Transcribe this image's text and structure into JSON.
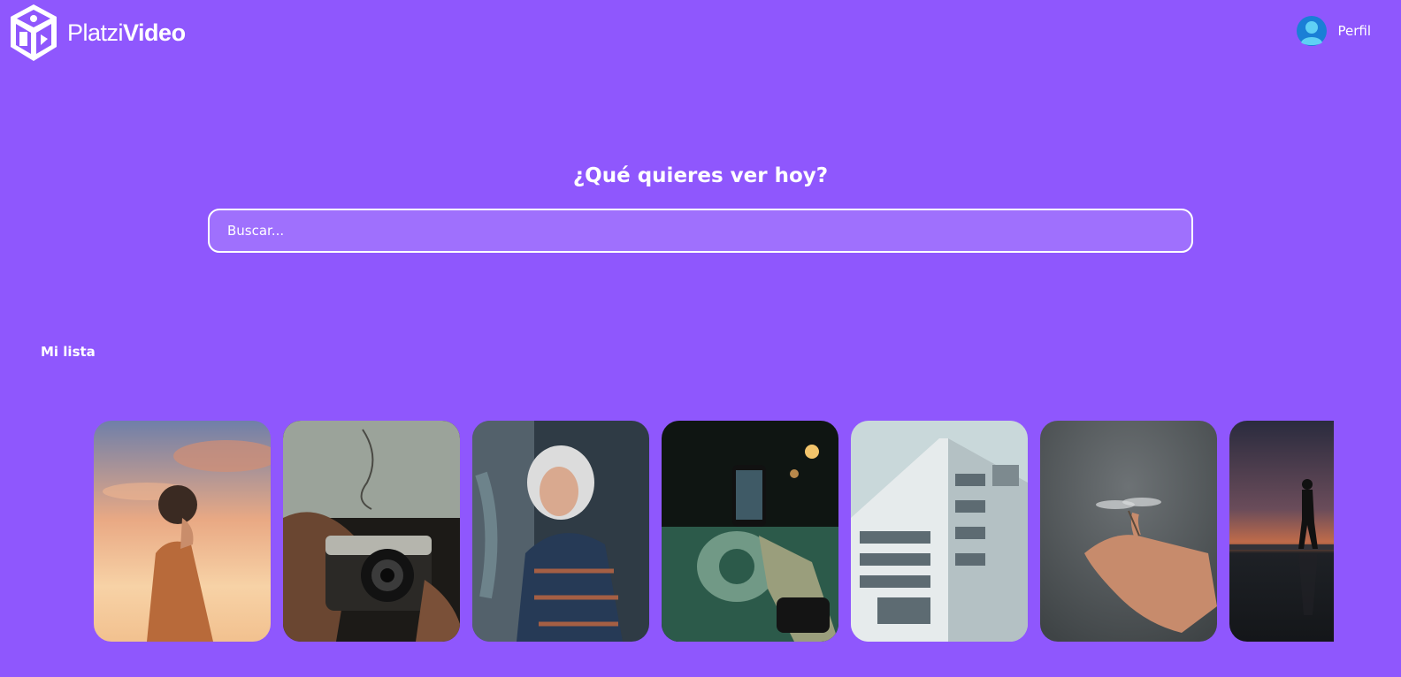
{
  "header": {
    "logo": {
      "name_light": "Platzi",
      "name_bold": "Video",
      "icon": "cube-logo-icon"
    },
    "profile": {
      "label": "Perfil",
      "icon": "user-avatar-icon"
    }
  },
  "hero": {
    "title": "¿Qué quieres ver hoy?",
    "search": {
      "placeholder": "Buscar...",
      "value": ""
    }
  },
  "sections": [
    {
      "title": "Mi lista",
      "items": [
        {
          "name": "woman-sunset-sky",
          "colors": [
            "#6f7fa9",
            "#f4b88b",
            "#c96d3d"
          ]
        },
        {
          "name": "hands-holding-camera",
          "colors": [
            "#9ba39a",
            "#4a3527",
            "#1c1a17"
          ]
        },
        {
          "name": "silver-haired-woman-portrait",
          "colors": [
            "#5c6b74",
            "#2f3b45",
            "#a55f44"
          ]
        },
        {
          "name": "phone-recording-night",
          "colors": [
            "#0f1512",
            "#2c5a4a",
            "#8fb3a0"
          ]
        },
        {
          "name": "white-building-facade",
          "colors": [
            "#c9d8da",
            "#e6ebec",
            "#7d8a8f"
          ]
        },
        {
          "name": "hand-with-dragonfly",
          "colors": [
            "#4b5052",
            "#6d7275",
            "#c78b6c"
          ]
        },
        {
          "name": "silhouette-sea-sunset",
          "colors": [
            "#2a2b3e",
            "#c06b4a",
            "#141619"
          ]
        }
      ]
    }
  ],
  "colors": {
    "background": "#8f57fd",
    "text": "#ffffff",
    "avatar": "#1a7fd6"
  }
}
